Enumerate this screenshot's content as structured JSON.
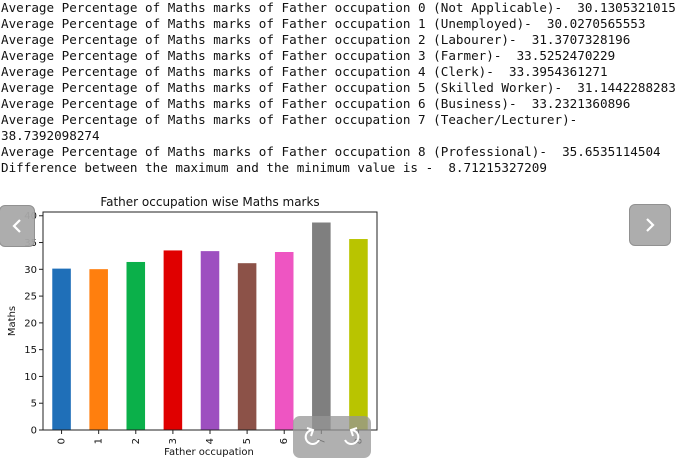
{
  "output_lines": [
    "Average Percentage of Maths marks of Father occupation 0 (Not Applicable)-  30.1305321015",
    "Average Percentage of Maths marks of Father occupation 1 (Unemployed)-  30.0270565553",
    "Average Percentage of Maths marks of Father occupation 2 (Labourer)-  31.3707328196",
    "Average Percentage of Maths marks of Father occupation 3 (Farmer)-  33.5252470229",
    "Average Percentage of Maths marks of Father occupation 4 (Clerk)-  33.3954361271",
    "Average Percentage of Maths marks of Father occupation 5 (Skilled Worker)-  31.1442288283",
    "Average Percentage of Maths marks of Father occupation 6 (Business)-  33.2321360896",
    "Average Percentage of Maths marks of Father occupation 7 (Teacher/Lecturer)-",
    "38.7392098274",
    "Average Percentage of Maths marks of Father occupation 8 (Professional)-  35.6535114504",
    "Difference between the maximum and the minimum value is -  8.71215327209"
  ],
  "chart_data": {
    "type": "bar",
    "title": "Father occupation wise Maths marks",
    "xlabel": "Father occupation",
    "ylabel": "Maths",
    "categories": [
      "0",
      "1",
      "2",
      "3",
      "4",
      "5",
      "6",
      "7",
      "8"
    ],
    "values": [
      30.1305321015,
      30.0270565553,
      31.3707328196,
      33.5252470229,
      33.3954361271,
      31.1442288283,
      33.2321360896,
      38.7392098274,
      35.6535114504
    ],
    "colors": [
      "#1f6fb8",
      "#ff7f0e",
      "#0bb04a",
      "#e00000",
      "#9d4fc0",
      "#8c5248",
      "#ee55c2",
      "#7f7f7f",
      "#b9c400"
    ],
    "yticks": [
      0,
      5,
      10,
      15,
      20,
      25,
      30,
      35,
      40
    ],
    "ylim": [
      0,
      40.7
    ]
  },
  "icons": {
    "prev": "chevron-left-icon",
    "next": "chevron-right-icon",
    "controls": "carousel-controls-icon"
  }
}
